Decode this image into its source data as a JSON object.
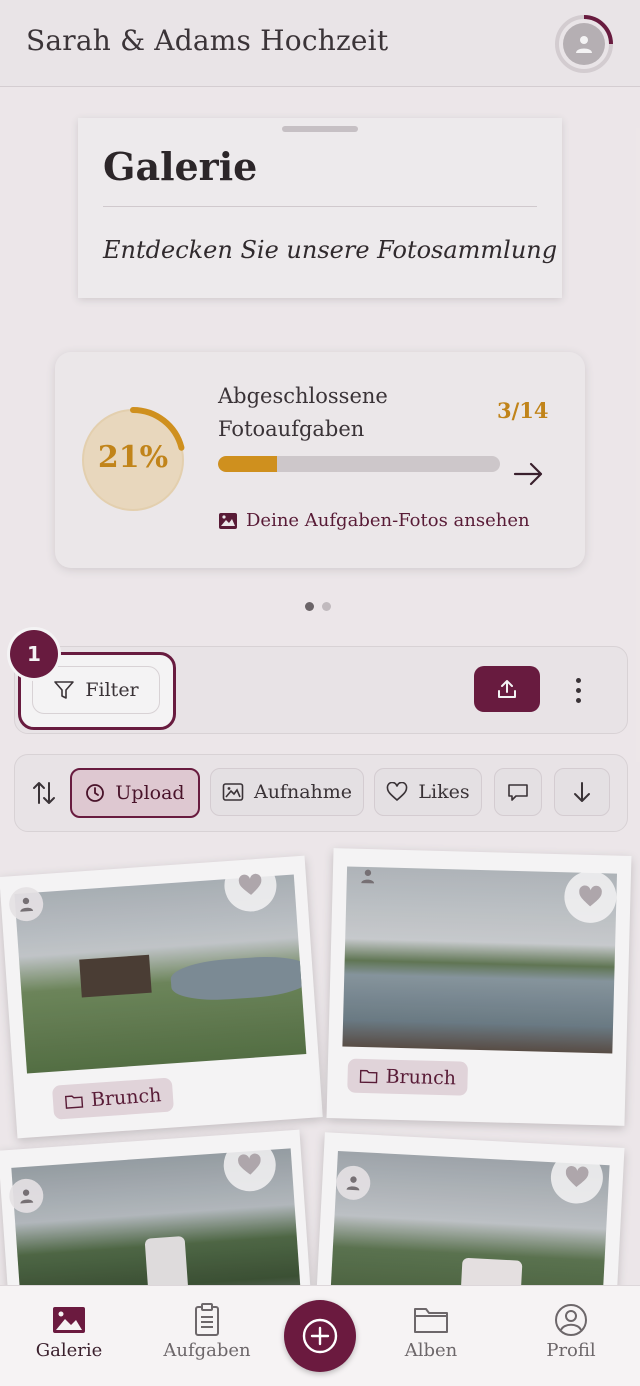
{
  "header": {
    "title": "Sarah & Adams Hochzeit",
    "avatar_icon": "user-icon"
  },
  "hero": {
    "title": "Galerie",
    "subtitle": "Entdecken Sie unsere Fotosammlung"
  },
  "progress": {
    "percent_label": "21%",
    "percent_value": 0.21,
    "label": "Abgeschlossene Fotoaufgaben",
    "count": "3/14",
    "photos_link": "Deine Aufgaben-Fotos ansehen"
  },
  "carousel": {
    "pages": 2,
    "active": 0
  },
  "toolbar": {
    "badge": "1",
    "filter_label": "Filter"
  },
  "sort": {
    "chips": [
      {
        "label": "Upload",
        "icon": "clock-icon",
        "active": true
      },
      {
        "label": "Aufnahme",
        "icon": "image-icon",
        "active": false
      },
      {
        "label": "Likes",
        "icon": "heart-icon",
        "active": false
      }
    ]
  },
  "photos": [
    {
      "tag": "Brunch"
    },
    {
      "tag": "Brunch"
    }
  ],
  "nav": {
    "items": [
      {
        "label": "Galerie",
        "icon": "gallery-icon",
        "active": true
      },
      {
        "label": "Aufgaben",
        "icon": "clipboard-icon",
        "active": false
      },
      {
        "label": "Alben",
        "icon": "folder-icon",
        "active": false
      },
      {
        "label": "Profil",
        "icon": "profile-icon",
        "active": false
      }
    ],
    "fab_icon": "plus-circle-icon"
  },
  "colors": {
    "brand": "#6b1a3f",
    "accent": "#d8961c"
  }
}
